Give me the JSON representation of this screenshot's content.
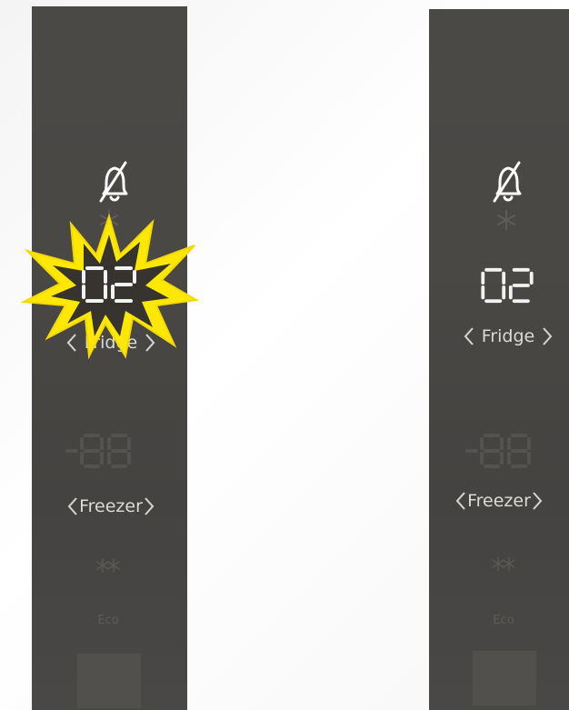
{
  "left_panel": {
    "temperature": "02",
    "fridge_label": "Fridge",
    "freezer_label": "Freezer",
    "eco_label": "Eco",
    "highlighted": true
  },
  "right_panel": {
    "temperature": "02",
    "fridge_label": "Fridge",
    "freezer_label": "Freezer",
    "eco_label": "Eco",
    "highlighted": false
  },
  "icons": {
    "alarm": "bell-off-icon",
    "super_cool": "snowflake-icon",
    "super_freeze": "double-snowflake-icon",
    "prev": "chevron-left-icon",
    "next": "chevron-right-icon",
    "highlight": "starburst-highlight"
  },
  "colors": {
    "panel": "#4a4845",
    "display_text": "#f2f2f2",
    "burst_fill": "#ffe800",
    "burst_inner": "#37342f"
  }
}
